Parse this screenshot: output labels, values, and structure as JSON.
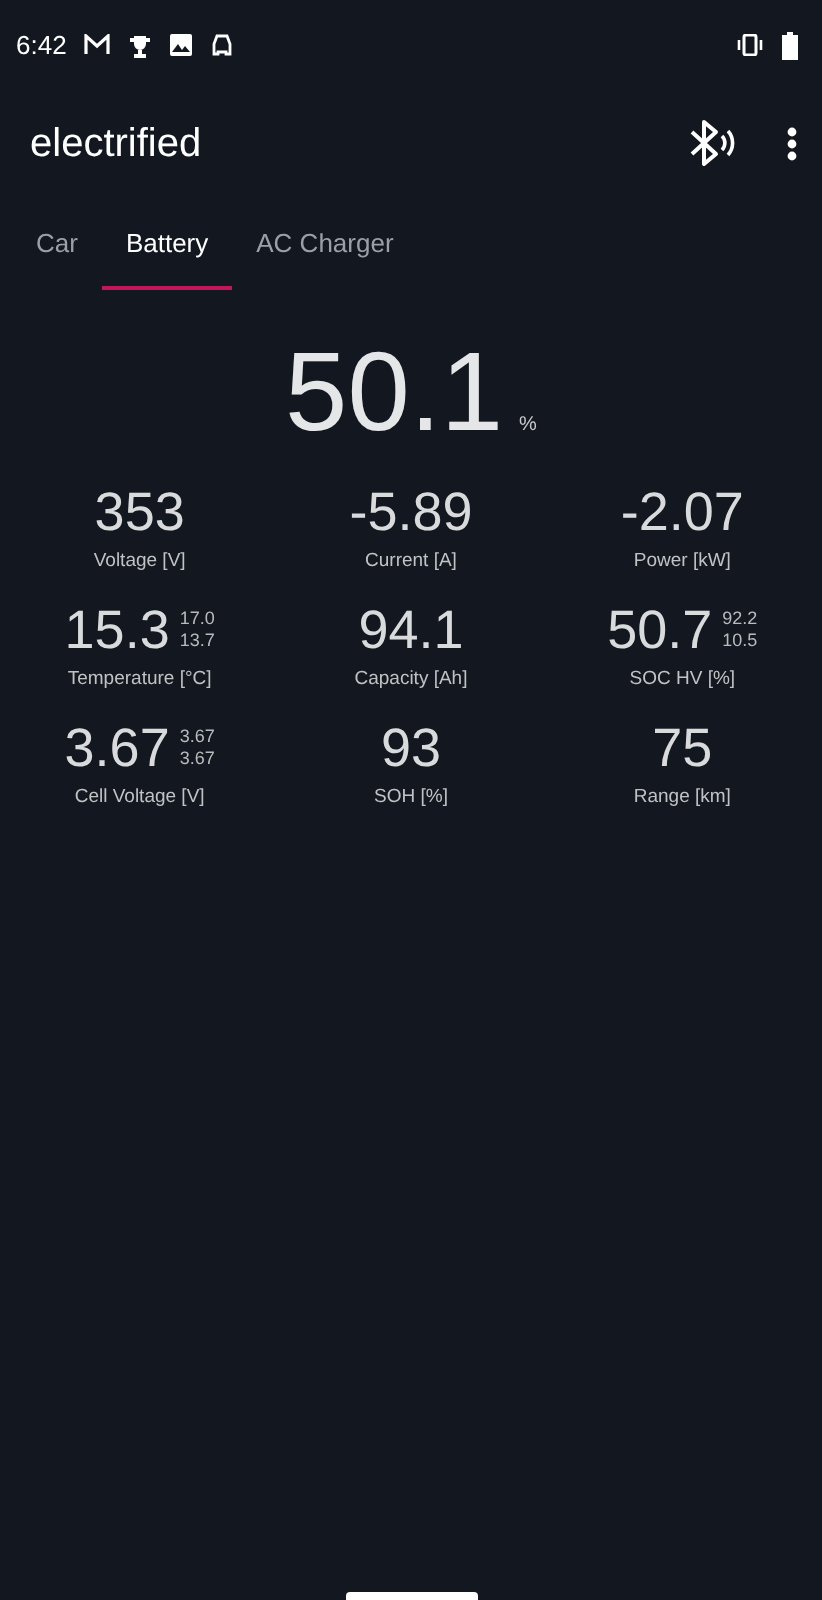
{
  "status_bar": {
    "time": "6:42"
  },
  "app_bar": {
    "title": "electrified"
  },
  "tabs": [
    {
      "label": "Car",
      "selected": false
    },
    {
      "label": "Battery",
      "selected": true
    },
    {
      "label": "AC Charger",
      "selected": false
    }
  ],
  "main_value": {
    "value": "50.1",
    "unit": "%"
  },
  "metrics": [
    {
      "value": "353",
      "label": "Voltage [V]"
    },
    {
      "value": "-5.89",
      "label": "Current [A]"
    },
    {
      "value": "-2.07",
      "label": "Power [kW]"
    },
    {
      "value": "15.3",
      "max": "17.0",
      "min": "13.7",
      "label": "Temperature [°C]"
    },
    {
      "value": "94.1",
      "label": "Capacity [Ah]"
    },
    {
      "value": "50.7",
      "max": "92.2",
      "min": "10.5",
      "label": "SOC HV [%]"
    },
    {
      "value": "3.67",
      "max": "3.67",
      "min": "3.67",
      "label": "Cell Voltage [V]"
    },
    {
      "value": "93",
      "label": "SOH [%]"
    },
    {
      "value": "75",
      "label": "Range [km]"
    }
  ]
}
